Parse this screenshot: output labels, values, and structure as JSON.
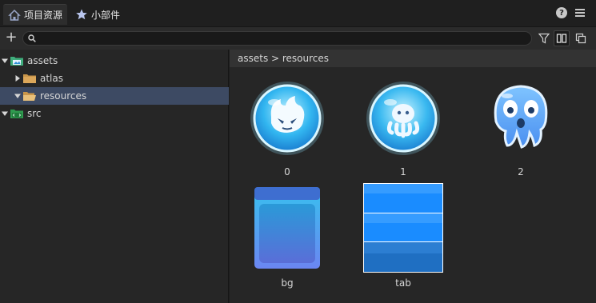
{
  "tabs": [
    {
      "label": "项目资源",
      "icon": "home-icon"
    },
    {
      "label": "小部件",
      "icon": "star-icon"
    }
  ],
  "toolbar": {
    "search_value": "",
    "search_placeholder": ""
  },
  "tree": [
    {
      "label": "assets",
      "icon": "assets-folder-icon",
      "expanded": true
    },
    {
      "label": "atlas",
      "icon": "folder-icon",
      "expanded": false
    },
    {
      "label": "resources",
      "icon": "folder-open-icon",
      "expanded": true,
      "selected": true
    },
    {
      "label": "src",
      "icon": "src-folder-icon",
      "expanded": true
    }
  ],
  "breadcrumb": "assets > resources",
  "assets": [
    {
      "name": "0",
      "icon": "spirit-orb-icon"
    },
    {
      "name": "1",
      "icon": "octopus-orb-icon"
    },
    {
      "name": "2",
      "icon": "jelly-octopus-icon"
    },
    {
      "name": "bg",
      "icon": "panel-bg-icon"
    },
    {
      "name": "tab",
      "icon": "tab-strip-icon"
    }
  ],
  "colors": {
    "selection": "#3d4a63",
    "accent_blue": "#1a8cff"
  }
}
